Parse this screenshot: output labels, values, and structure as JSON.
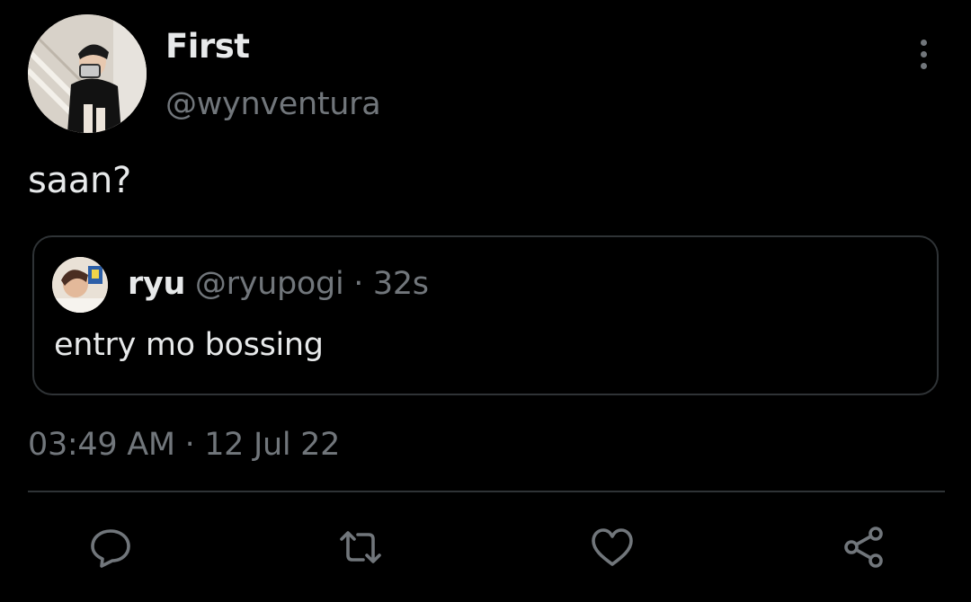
{
  "author": {
    "display_name": "First",
    "handle": "@wynventura"
  },
  "tweet": {
    "text": "saan?"
  },
  "quoted_tweet": {
    "name": "ryu",
    "handle": "@ryupogi",
    "separator": "·",
    "time": "32s",
    "text": "entry mo bossing"
  },
  "meta": {
    "time": "03:49 AM",
    "separator": "·",
    "date": "12 Jul 22"
  },
  "actions": {
    "icons": [
      "reply-icon",
      "retweet-icon",
      "like-icon",
      "share-icon"
    ]
  },
  "colors": {
    "background": "#000000",
    "text": "#e7e9ea",
    "secondary": "#71767b",
    "border": "#2f3336"
  }
}
